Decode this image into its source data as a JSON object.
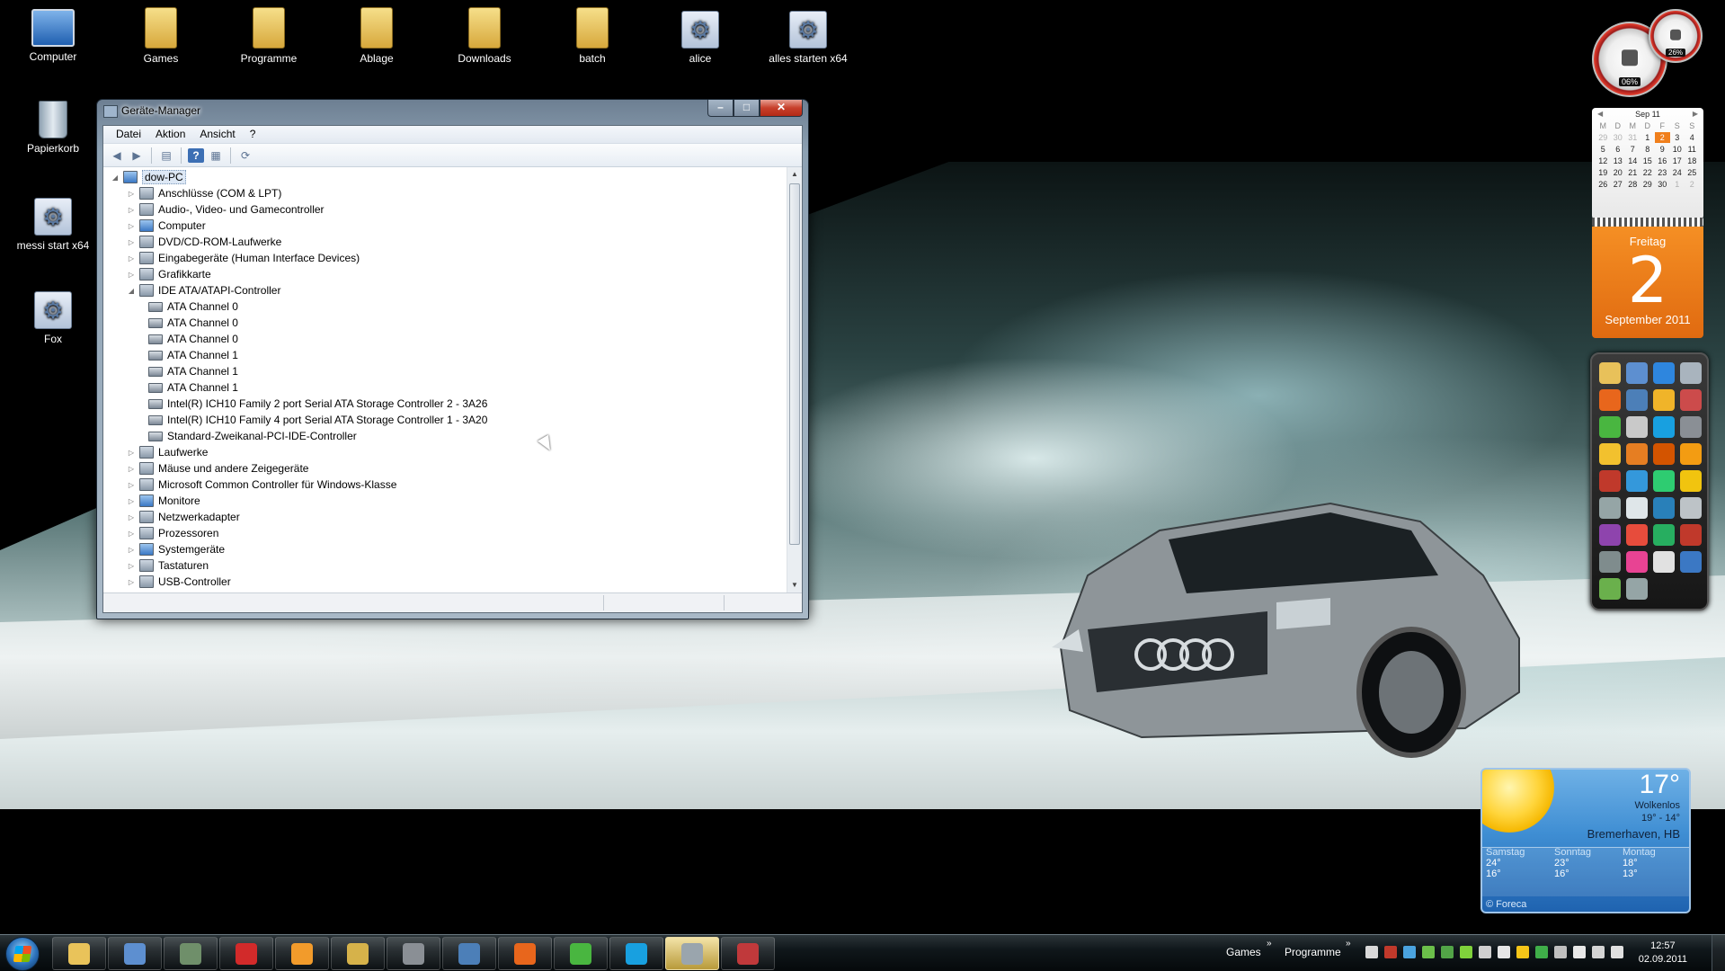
{
  "desktop": {
    "icons": [
      {
        "label": "Computer",
        "icon": "computer-icon"
      },
      {
        "label": "Games",
        "icon": "folder-icon"
      },
      {
        "label": "Programme",
        "icon": "folder-icon"
      },
      {
        "label": "Ablage",
        "icon": "folder-icon"
      },
      {
        "label": "Downloads",
        "icon": "folder-icon"
      },
      {
        "label": "batch",
        "icon": "folder-icon"
      },
      {
        "label": "alice",
        "icon": "gear-icon"
      },
      {
        "label": "alles starten x64",
        "icon": "gear-icon"
      },
      {
        "label": "Papierkorb",
        "icon": "recycle-bin-icon"
      },
      {
        "label": "messi start x64",
        "icon": "gear-icon"
      },
      {
        "label": "Fox",
        "icon": "gear-icon"
      }
    ]
  },
  "window": {
    "title": "Geräte-Manager",
    "menu": [
      "Datei",
      "Aktion",
      "Ansicht",
      "?"
    ],
    "tree": {
      "root": "dow-PC",
      "items": [
        "Anschlüsse (COM & LPT)",
        "Audio-, Video- und Gamecontroller",
        "Computer",
        "DVD/CD-ROM-Laufwerke",
        "Eingabegeräte (Human Interface Devices)",
        "Grafikkarte",
        "IDE ATA/ATAPI-Controller",
        "Laufwerke",
        "Mäuse und andere Zeigegeräte",
        "Microsoft Common Controller für Windows-Klasse",
        "Monitore",
        "Netzwerkadapter",
        "Prozessoren",
        "Systemgeräte",
        "Tastaturen",
        "USB-Controller"
      ],
      "ide_children": [
        "ATA Channel 0",
        "ATA Channel 0",
        "ATA Channel 0",
        "ATA Channel 1",
        "ATA Channel 1",
        "ATA Channel 1",
        "Intel(R) ICH10 Family 2 port Serial ATA Storage Controller 2 - 3A26",
        "Intel(R) ICH10 Family 4 port Serial ATA Storage Controller 1 - 3A20",
        "Standard-Zweikanal-PCI-IDE-Controller"
      ]
    }
  },
  "gadgets": {
    "cpu_gauge": {
      "value": "06%"
    },
    "ram_gauge": {
      "value": "26%"
    },
    "calendar": {
      "month_label": "Sep 11",
      "weekdays": [
        "M",
        "D",
        "M",
        "D",
        "F",
        "S",
        "S"
      ],
      "days": [
        [
          "29",
          "30",
          "31",
          "1",
          "2",
          "3",
          "4"
        ],
        [
          "5",
          "6",
          "7",
          "8",
          "9",
          "10",
          "11"
        ],
        [
          "12",
          "13",
          "14",
          "15",
          "16",
          "17",
          "18"
        ],
        [
          "19",
          "20",
          "21",
          "22",
          "23",
          "24",
          "25"
        ],
        [
          "26",
          "27",
          "28",
          "29",
          "30",
          "1",
          "2"
        ]
      ],
      "weekday_name": "Freitag",
      "day_number": "2",
      "month_year": "September 2011"
    },
    "weather": {
      "temp": "17°",
      "condition": "Wolkenlos",
      "range": "19° - 14°",
      "city": "Bremerhaven, HB",
      "forecast": [
        {
          "day": "Samstag",
          "high": "24°",
          "low": "16°"
        },
        {
          "day": "Sonntag",
          "high": "23°",
          "low": "16°"
        },
        {
          "day": "Montag",
          "high": "18°",
          "low": "13°"
        }
      ],
      "brand": "© Foreca"
    }
  },
  "taskbar": {
    "toolbars": [
      "Games",
      "Programme"
    ],
    "chevron": "»",
    "time": "12:57",
    "date": "02.09.2011",
    "buttons": [
      {
        "icon": "explorer-icon",
        "color": "#e9c35a"
      },
      {
        "icon": "control-panel-icon",
        "color": "#5d8fd0"
      },
      {
        "icon": "device-manager-icon",
        "color": "#6f8f6a"
      },
      {
        "icon": "flash-icon",
        "color": "#d22a2a"
      },
      {
        "icon": "media-player-icon",
        "color": "#f29b2b"
      },
      {
        "icon": "winamp-icon",
        "color": "#d6b24a"
      },
      {
        "icon": "steam-icon",
        "color": "#8a8f95"
      },
      {
        "icon": "thunderbird-icon",
        "color": "#4c7fb8"
      },
      {
        "icon": "firefox-icon",
        "color": "#e8661c"
      },
      {
        "icon": "icq-icon",
        "color": "#49b640"
      },
      {
        "icon": "skype-icon",
        "color": "#18a0e0"
      },
      {
        "icon": "network-icon",
        "color": "#9aa5ad"
      },
      {
        "icon": "toolbox-icon",
        "color": "#c0393b"
      }
    ]
  }
}
